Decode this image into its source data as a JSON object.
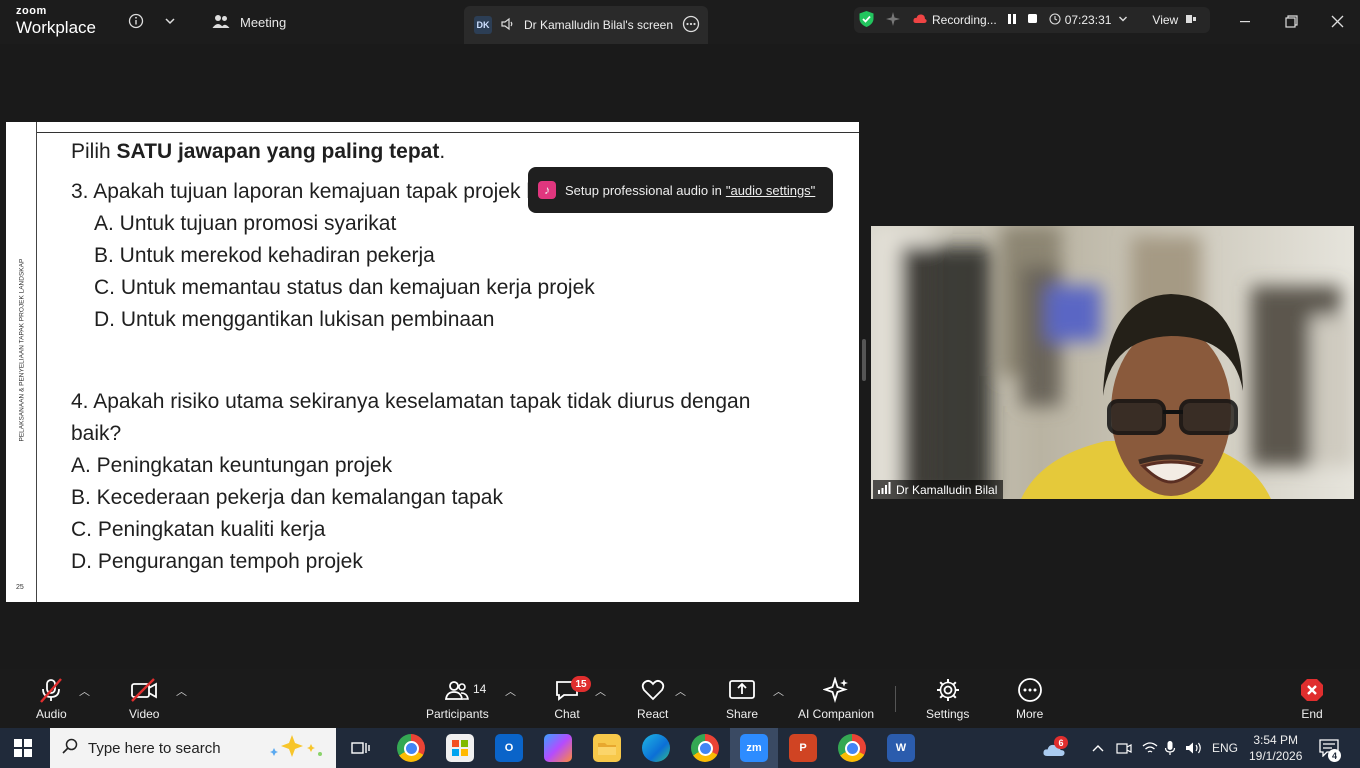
{
  "app": {
    "brand_top": "zoom",
    "brand_name": "Workplace",
    "meeting_label": "Meeting"
  },
  "screen_share": {
    "initials": "DK",
    "title": "Dr Kamalludin Bilal's screen"
  },
  "recording": {
    "status": "Recording...",
    "timer": "07:23:31",
    "view_label": "View"
  },
  "slide": {
    "side_text": "PELAKSANAAN & PENYELIAAN TAPAK PROJEK LANDSKAP",
    "page_number": "25",
    "instruction_prefix": "Pilih ",
    "instruction_bold": "SATU jawapan yang paling tepat",
    "instruction_suffix": ".",
    "q3": "3. Apakah tujuan laporan kemajuan tapak projek landskap?",
    "q3_options": [
      "A. Untuk tujuan promosi syarikat",
      "B. Untuk merekod kehadiran pekerja",
      "C. Untuk memantau status dan kemajuan kerja projek",
      "D. Untuk menggantikan lukisan pembinaan"
    ],
    "q4_line1": "4. Apakah risiko utama sekiranya keselamatan tapak tidak diurus dengan",
    "q4_line2": "baik?",
    "q4_options": [
      "A. Peningkatan keuntungan projek",
      "B. Kecederaan pekerja dan kemalangan tapak",
      "C. Peningkatan kualiti kerja",
      "D. Pengurangan tempoh projek"
    ]
  },
  "toast": {
    "text": "Setup professional audio in",
    "link": "\"audio settings\""
  },
  "video": {
    "participant_name": "Dr Kamalludin Bilal"
  },
  "toolbar": {
    "audio": "Audio",
    "video": "Video",
    "participants": "Participants",
    "participants_count": "14",
    "chat": "Chat",
    "chat_badge": "15",
    "react": "React",
    "share": "Share",
    "ai_companion": "AI Companion",
    "settings": "Settings",
    "more": "More",
    "end": "End"
  },
  "taskbar": {
    "search_placeholder": "Type here to search",
    "weather_badge": "6",
    "language": "ENG",
    "time": "3:54 PM",
    "date": "19/1/2026",
    "notification_count": "4"
  }
}
